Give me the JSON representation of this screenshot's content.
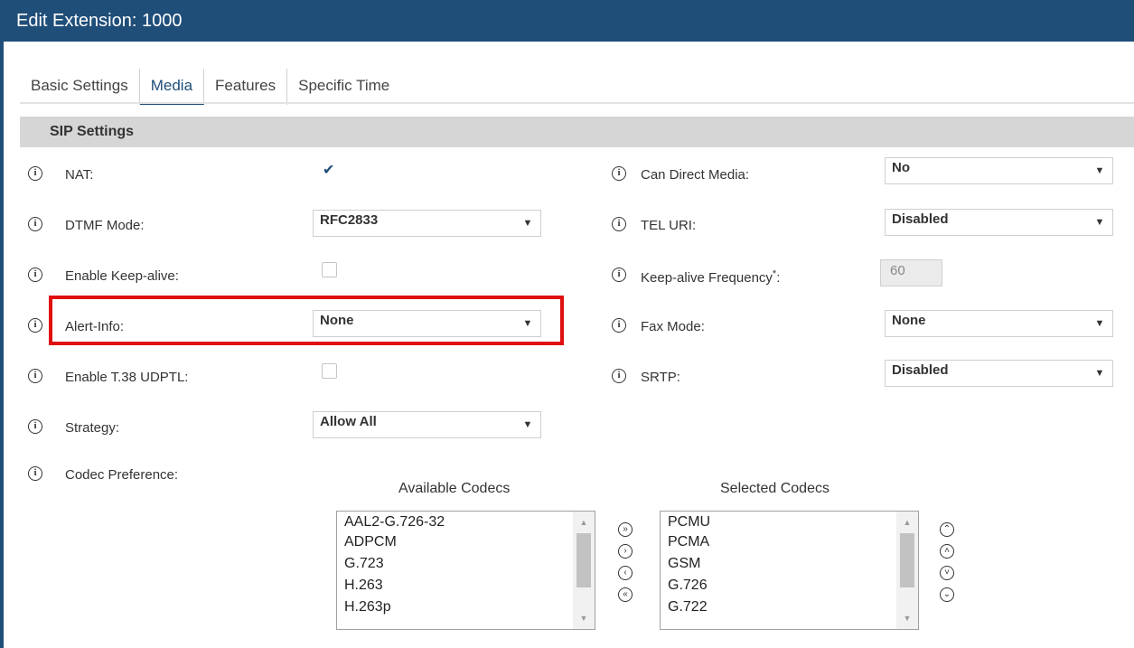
{
  "window": {
    "title": "Edit Extension: 1000"
  },
  "tabs": [
    "Basic Settings",
    "Media",
    "Features",
    "Specific Time"
  ],
  "active_tab": "Media",
  "section": {
    "title": "SIP Settings"
  },
  "fields": {
    "nat": {
      "label": "NAT:",
      "checked": true
    },
    "dtmf_mode": {
      "label": "DTMF Mode:",
      "value": "RFC2833"
    },
    "enable_keepalive": {
      "label": "Enable Keep-alive:",
      "checked": false
    },
    "alert_info": {
      "label": "Alert-Info:",
      "value": "None"
    },
    "enable_t38": {
      "label": "Enable T.38 UDPTL:",
      "checked": false
    },
    "strategy": {
      "label": "Strategy:",
      "value": "Allow All"
    },
    "codec_pref": {
      "label": "Codec Preference:"
    },
    "can_direct_media": {
      "label": "Can Direct Media:",
      "value": "No"
    },
    "tel_uri": {
      "label": "TEL URI:",
      "value": "Disabled"
    },
    "keepalive_freq": {
      "label": "Keep-alive Frequency",
      "required_mark": "*",
      "suffix": ":",
      "value": "60"
    },
    "fax_mode": {
      "label": "Fax Mode:",
      "value": "None"
    },
    "srtp": {
      "label": "SRTP:",
      "value": "Disabled"
    }
  },
  "codecs": {
    "available_title": "Available Codecs",
    "selected_title": "Selected Codecs",
    "available": [
      "AAL2-G.726-32",
      "ADPCM",
      "G.723",
      "H.263",
      "H.263p"
    ],
    "selected": [
      "PCMU",
      "PCMA",
      "GSM",
      "G.726",
      "G.722"
    ]
  },
  "icons": {
    "info": "i",
    "dropdown": "▼",
    "check": "✔",
    "scroll_up": "▲",
    "scroll_down": "▼",
    "move_all_right": "»",
    "move_right": "›",
    "move_left": "‹",
    "move_all_left": "«",
    "move_top": "⌃",
    "move_up": "˄",
    "move_down": "˅",
    "move_bottom": "⌄"
  },
  "colors": {
    "title_bar": "#1f4e79",
    "highlight_border": "#e01010",
    "section_bg": "#d6d6d6"
  }
}
